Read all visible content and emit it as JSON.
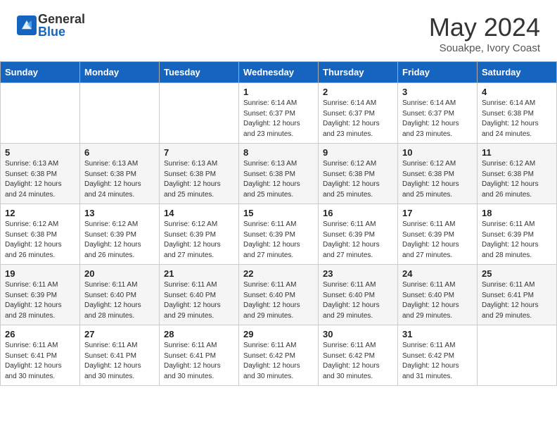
{
  "header": {
    "logo_general": "General",
    "logo_blue": "Blue",
    "month_year": "May 2024",
    "location": "Souakpe, Ivory Coast"
  },
  "days_of_week": [
    "Sunday",
    "Monday",
    "Tuesday",
    "Wednesday",
    "Thursday",
    "Friday",
    "Saturday"
  ],
  "weeks": [
    [
      {
        "day": "",
        "info": ""
      },
      {
        "day": "",
        "info": ""
      },
      {
        "day": "",
        "info": ""
      },
      {
        "day": "1",
        "info": "Sunrise: 6:14 AM\nSunset: 6:37 PM\nDaylight: 12 hours\nand 23 minutes."
      },
      {
        "day": "2",
        "info": "Sunrise: 6:14 AM\nSunset: 6:37 PM\nDaylight: 12 hours\nand 23 minutes."
      },
      {
        "day": "3",
        "info": "Sunrise: 6:14 AM\nSunset: 6:37 PM\nDaylight: 12 hours\nand 23 minutes."
      },
      {
        "day": "4",
        "info": "Sunrise: 6:14 AM\nSunset: 6:38 PM\nDaylight: 12 hours\nand 24 minutes."
      }
    ],
    [
      {
        "day": "5",
        "info": "Sunrise: 6:13 AM\nSunset: 6:38 PM\nDaylight: 12 hours\nand 24 minutes."
      },
      {
        "day": "6",
        "info": "Sunrise: 6:13 AM\nSunset: 6:38 PM\nDaylight: 12 hours\nand 24 minutes."
      },
      {
        "day": "7",
        "info": "Sunrise: 6:13 AM\nSunset: 6:38 PM\nDaylight: 12 hours\nand 25 minutes."
      },
      {
        "day": "8",
        "info": "Sunrise: 6:13 AM\nSunset: 6:38 PM\nDaylight: 12 hours\nand 25 minutes."
      },
      {
        "day": "9",
        "info": "Sunrise: 6:12 AM\nSunset: 6:38 PM\nDaylight: 12 hours\nand 25 minutes."
      },
      {
        "day": "10",
        "info": "Sunrise: 6:12 AM\nSunset: 6:38 PM\nDaylight: 12 hours\nand 25 minutes."
      },
      {
        "day": "11",
        "info": "Sunrise: 6:12 AM\nSunset: 6:38 PM\nDaylight: 12 hours\nand 26 minutes."
      }
    ],
    [
      {
        "day": "12",
        "info": "Sunrise: 6:12 AM\nSunset: 6:38 PM\nDaylight: 12 hours\nand 26 minutes."
      },
      {
        "day": "13",
        "info": "Sunrise: 6:12 AM\nSunset: 6:39 PM\nDaylight: 12 hours\nand 26 minutes."
      },
      {
        "day": "14",
        "info": "Sunrise: 6:12 AM\nSunset: 6:39 PM\nDaylight: 12 hours\nand 27 minutes."
      },
      {
        "day": "15",
        "info": "Sunrise: 6:11 AM\nSunset: 6:39 PM\nDaylight: 12 hours\nand 27 minutes."
      },
      {
        "day": "16",
        "info": "Sunrise: 6:11 AM\nSunset: 6:39 PM\nDaylight: 12 hours\nand 27 minutes."
      },
      {
        "day": "17",
        "info": "Sunrise: 6:11 AM\nSunset: 6:39 PM\nDaylight: 12 hours\nand 27 minutes."
      },
      {
        "day": "18",
        "info": "Sunrise: 6:11 AM\nSunset: 6:39 PM\nDaylight: 12 hours\nand 28 minutes."
      }
    ],
    [
      {
        "day": "19",
        "info": "Sunrise: 6:11 AM\nSunset: 6:39 PM\nDaylight: 12 hours\nand 28 minutes."
      },
      {
        "day": "20",
        "info": "Sunrise: 6:11 AM\nSunset: 6:40 PM\nDaylight: 12 hours\nand 28 minutes."
      },
      {
        "day": "21",
        "info": "Sunrise: 6:11 AM\nSunset: 6:40 PM\nDaylight: 12 hours\nand 29 minutes."
      },
      {
        "day": "22",
        "info": "Sunrise: 6:11 AM\nSunset: 6:40 PM\nDaylight: 12 hours\nand 29 minutes."
      },
      {
        "day": "23",
        "info": "Sunrise: 6:11 AM\nSunset: 6:40 PM\nDaylight: 12 hours\nand 29 minutes."
      },
      {
        "day": "24",
        "info": "Sunrise: 6:11 AM\nSunset: 6:40 PM\nDaylight: 12 hours\nand 29 minutes."
      },
      {
        "day": "25",
        "info": "Sunrise: 6:11 AM\nSunset: 6:41 PM\nDaylight: 12 hours\nand 29 minutes."
      }
    ],
    [
      {
        "day": "26",
        "info": "Sunrise: 6:11 AM\nSunset: 6:41 PM\nDaylight: 12 hours\nand 30 minutes."
      },
      {
        "day": "27",
        "info": "Sunrise: 6:11 AM\nSunset: 6:41 PM\nDaylight: 12 hours\nand 30 minutes."
      },
      {
        "day": "28",
        "info": "Sunrise: 6:11 AM\nSunset: 6:41 PM\nDaylight: 12 hours\nand 30 minutes."
      },
      {
        "day": "29",
        "info": "Sunrise: 6:11 AM\nSunset: 6:42 PM\nDaylight: 12 hours\nand 30 minutes."
      },
      {
        "day": "30",
        "info": "Sunrise: 6:11 AM\nSunset: 6:42 PM\nDaylight: 12 hours\nand 30 minutes."
      },
      {
        "day": "31",
        "info": "Sunrise: 6:11 AM\nSunset: 6:42 PM\nDaylight: 12 hours\nand 31 minutes."
      },
      {
        "day": "",
        "info": ""
      }
    ]
  ]
}
